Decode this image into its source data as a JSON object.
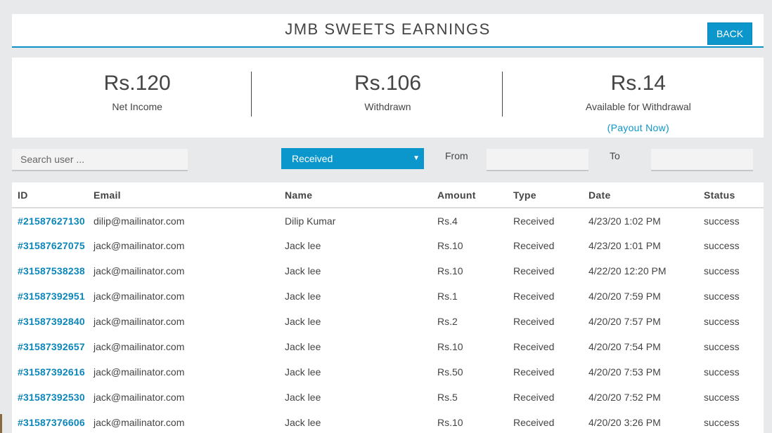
{
  "header": {
    "title": "JMB SWEETS EARNINGS",
    "back_label": "BACK"
  },
  "stats": [
    {
      "value": "Rs.120",
      "label": "Net Income"
    },
    {
      "value": "Rs.106",
      "label": "Withdrawn"
    },
    {
      "value": "Rs.14",
      "label": "Available for Withdrawal",
      "link": "(Payout Now)"
    }
  ],
  "filters": {
    "search_placeholder": "Search user ...",
    "type_selected": "Received",
    "from_label": "From",
    "to_label": "To"
  },
  "table": {
    "columns": [
      "ID",
      "Email",
      "Name",
      "Amount",
      "Type",
      "Date",
      "Status"
    ],
    "rows": [
      [
        "#21587627130",
        "dilip@mailinator.com",
        "Dilip Kumar",
        "Rs.4",
        "Received",
        "4/23/20 1:02 PM",
        "success"
      ],
      [
        "#31587627075",
        "jack@mailinator.com",
        "Jack lee",
        "Rs.10",
        "Received",
        "4/23/20 1:01 PM",
        "success"
      ],
      [
        "#31587538238",
        "jack@mailinator.com",
        "Jack lee",
        "Rs.10",
        "Received",
        "4/22/20 12:20 PM",
        "success"
      ],
      [
        "#31587392951",
        "jack@mailinator.com",
        "Jack lee",
        "Rs.1",
        "Received",
        "4/20/20 7:59 PM",
        "success"
      ],
      [
        "#31587392840",
        "jack@mailinator.com",
        "Jack lee",
        "Rs.2",
        "Received",
        "4/20/20 7:57 PM",
        "success"
      ],
      [
        "#31587392657",
        "jack@mailinator.com",
        "Jack lee",
        "Rs.10",
        "Received",
        "4/20/20 7:54 PM",
        "success"
      ],
      [
        "#31587392616",
        "jack@mailinator.com",
        "Jack lee",
        "Rs.50",
        "Received",
        "4/20/20 7:53 PM",
        "success"
      ],
      [
        "#31587392530",
        "jack@mailinator.com",
        "Jack lee",
        "Rs.5",
        "Received",
        "4/20/20 7:52 PM",
        "success"
      ],
      [
        "#31587376606",
        "jack@mailinator.com",
        "Jack lee",
        "Rs.10",
        "Received",
        "4/20/20 3:26 PM",
        "success"
      ]
    ]
  },
  "colors": {
    "accent": "#0c97cc",
    "background": "#e8e9eb"
  }
}
